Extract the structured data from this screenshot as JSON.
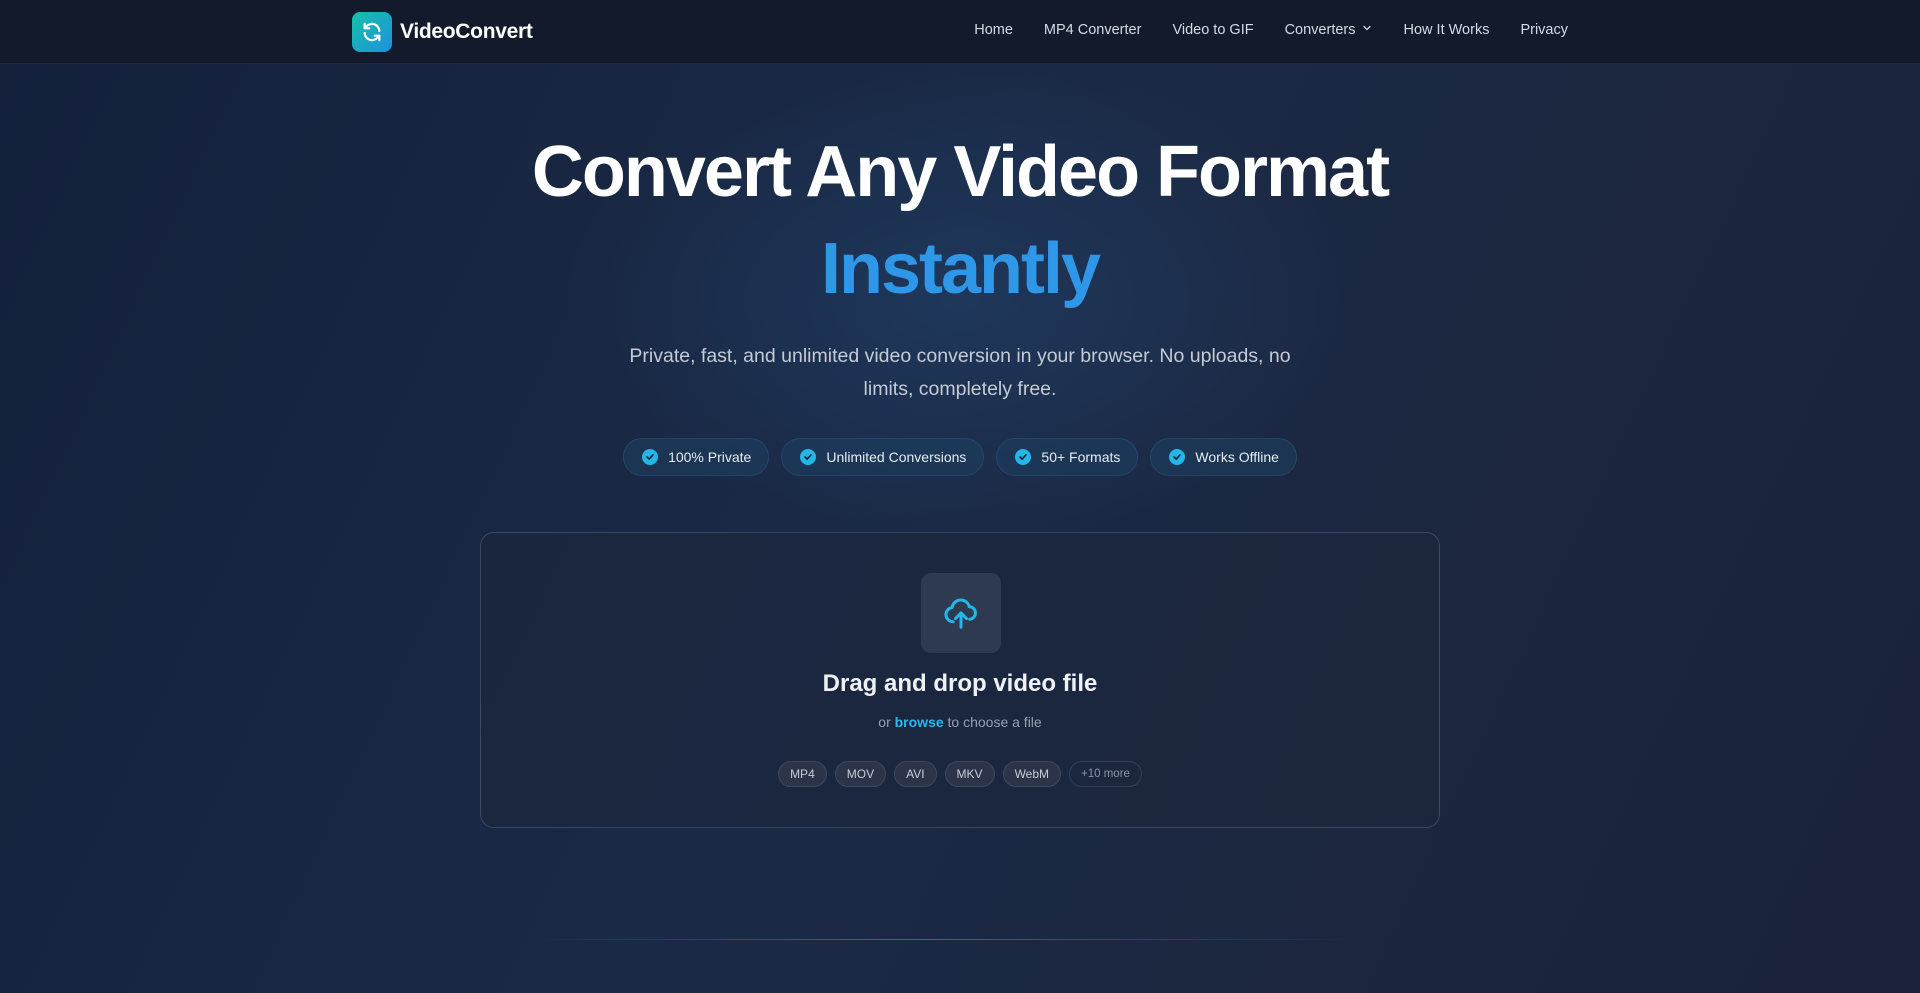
{
  "brand": {
    "name": "VideoConvert",
    "logo_icon": "refresh-icon"
  },
  "nav": {
    "links": [
      "Home",
      "MP4 Converter",
      "Video to GIF",
      "Converters",
      "How It Works",
      "Privacy"
    ]
  },
  "hero": {
    "title_line1": "Convert Any Video Format",
    "title_line2": "Instantly",
    "subtitle": "Private, fast, and unlimited video conversion in your browser. No uploads, no limits, completely free."
  },
  "features": [
    "100% Private",
    "Unlimited Conversions",
    "50+ Formats",
    "Works Offline"
  ],
  "dropzone": {
    "icon": "cloud-upload-icon",
    "title": "Drag and drop video file",
    "sub_prefix": "or",
    "browse_label": "browse",
    "sub_suffix": "to choose a file",
    "formats": [
      "MP4",
      "MOV",
      "AVI",
      "MKV",
      "WebM"
    ],
    "more_label": "+10 more"
  },
  "colors": {
    "accent_blue": "#2f97e8",
    "accent_cyan": "#22b7e8",
    "nav_bg": "#121a2c"
  }
}
